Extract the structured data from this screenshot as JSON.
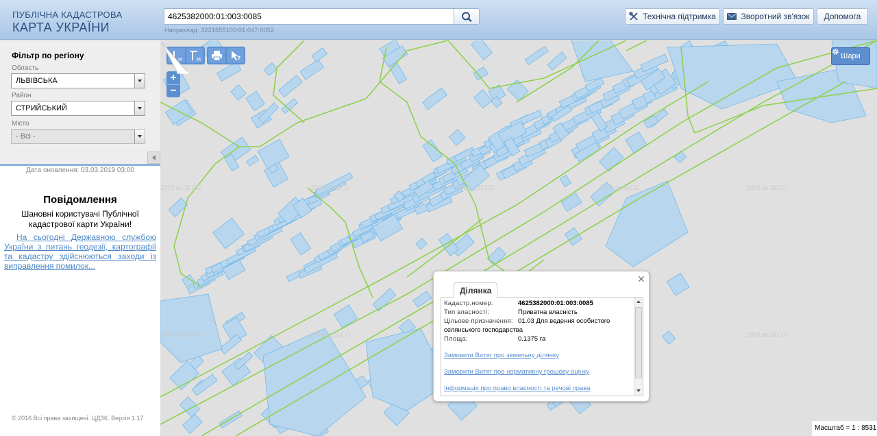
{
  "header": {
    "logo_line1": "ПУБЛІЧНА КАДАСТРОВА",
    "logo_line2": "КАРТА УКРАЇНИ",
    "search_value": "4625382000:01:003:0085",
    "search_example": "Наприклад: 3221655100:01:047:0052",
    "support_label": "Технічна підтримка",
    "feedback_label": "Зворотний зв'язок",
    "help_label": "Допомога"
  },
  "sidebar": {
    "filter_title": "Фільтр по регіону",
    "oblast_label": "Область",
    "oblast_value": "ЛЬВІВСЬКА",
    "rayon_label": "Район",
    "rayon_value": "СТРИЙСЬКИЙ",
    "city_label": "Місто",
    "city_value": "- Всі -",
    "update_date": "Дата оновлення: 03.03.2019 03:00",
    "message_title": "Повідомлення",
    "message_body": "Шановні користувачі Публічної кадастрової карти України!",
    "message_link": "На сьогодні Державною службою України з питань геодезії, картографії та кадастру здійснюються заходи із виправлення помилок...",
    "copyright": "© 2016 Всі права захищені. ЦДЗК. Версія 1.17"
  },
  "map": {
    "layers_label": "Шари",
    "scale": "Масштаб = 1 : 8531",
    "watermark": "2018.na.SLCG",
    "colors": {
      "parcel_fill": "#b8d6ee",
      "parcel_stroke": "#74b9e8",
      "boundary": "#8fd14f",
      "background": "#e0e0e0"
    }
  },
  "popup": {
    "tab_label": "Ділянка",
    "cadastral_key": "Кадастр.номер:",
    "cadastral_value": "4625382000:01:003:0085",
    "ownership_key": "Тип власності:",
    "ownership_value": "Приватна власність",
    "purpose_key": "Цільове призначення:",
    "purpose_value": "01.03 Для ведення особистого",
    "purpose_value_2": "селянського господарства",
    "area_key": "Площа:",
    "area_value": "0.1375 га",
    "link_extract": "Замовити Витяг про земельну ділянку",
    "link_valuation": "Замовити Витяг про нормативну грошову оцінку",
    "link_rights": "Інформація про право власності та речові права"
  }
}
